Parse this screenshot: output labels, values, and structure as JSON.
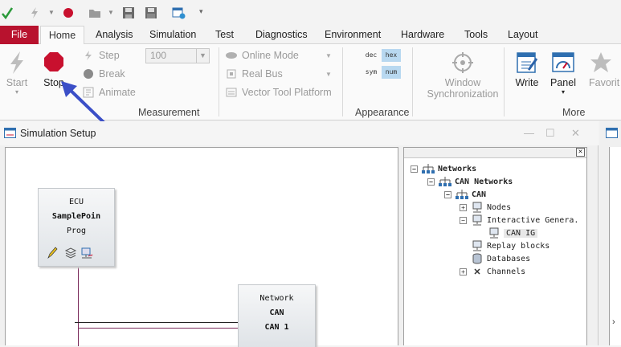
{
  "menu": {
    "file": "File",
    "items": [
      "Home",
      "Analysis",
      "Simulation",
      "Test",
      "Diagnostics",
      "Environment",
      "Hardware",
      "Tools",
      "Layout"
    ]
  },
  "ribbon": {
    "start": "Start",
    "stop": "Stop",
    "step": "Step",
    "break": "Break",
    "animate": "Animate",
    "speed_value": "100",
    "online_mode": "Online Mode",
    "real_bus": "Real Bus",
    "vector_tool_platform": "Vector Tool Platform",
    "fmt_dec": "dec",
    "fmt_hex": "hex",
    "fmt_sym": "sym",
    "fmt_num": "num",
    "window_sync_line1": "Window",
    "window_sync_line2": "Synchronization",
    "write": "Write",
    "panel": "Panel",
    "favorites": "Favorit",
    "group_measurement": "Measurement",
    "group_appearance": "Appearance",
    "group_more": "More"
  },
  "window": {
    "title": "Simulation Setup",
    "ecu_block": [
      "ECU",
      "SamplePoin",
      "Prog"
    ],
    "network_block": [
      "Network",
      "CAN",
      "CAN 1"
    ]
  },
  "tree": {
    "networks": "Networks",
    "can_networks": "CAN Networks",
    "can": "CAN",
    "nodes": "Nodes",
    "interactive_generators": "Interactive Genera.",
    "can_ig": "CAN IG",
    "replay_blocks": "Replay blocks",
    "databases": "Databases",
    "channels": "Channels"
  },
  "colors": {
    "file_tab": "#b8122e",
    "stop_button": "#c8102e",
    "hex_highlight": "#b8d8f0",
    "arrow": "#3b4fc7"
  }
}
